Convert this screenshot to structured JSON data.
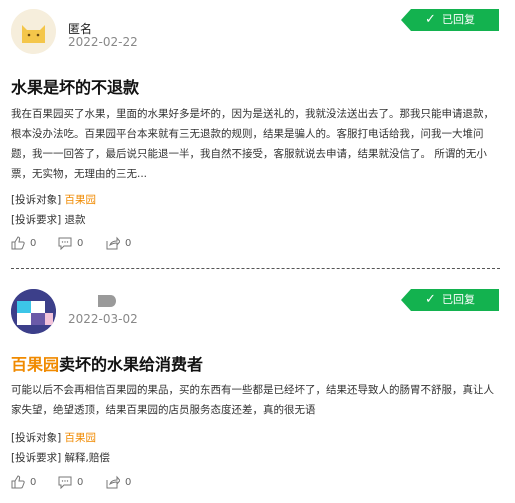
{
  "posts": [
    {
      "user": "匿名",
      "date": "2022-02-22",
      "status": "已回复",
      "title_prefix": "",
      "title": "水果是坏的不退款",
      "content": "我在百果园买了水果，里面的水果好多是坏的，因为是送礼的，我就没法送出去了。那我只能申请退款，根本没办法吃。百果园平台本来就有三无退款的规则，结果是骗人的。客服打电话给我，问我一大堆问题，我一一回答了，最后说只能退一半，我自然不接受，客服就说去申请，结果就没信了。 所谓的无小票，无实物，无理由的三无...",
      "target_label": "[投诉对象]",
      "target_value": "百果园",
      "request_label": "[投诉要求]",
      "request_value": "退款",
      "likes": "0",
      "comments": "0",
      "shares": "0"
    },
    {
      "user": "",
      "date": "2022-03-02",
      "status": "已回复",
      "title_prefix": "百果园",
      "title": "卖坏的水果给消费者",
      "content": "可能以后不会再相信百果园的果品，买的东西有一些都是已经坏了，结果还导致人的肠胃不舒服，真让人家失望，绝望透顶，结果百果园的店员服务态度还差，真的很无语",
      "target_label": "[投诉对象]",
      "target_value": "百果园",
      "request_label": "[投诉要求]",
      "request_value": "解释,赔偿",
      "likes": "0",
      "comments": "0",
      "shares": "0"
    }
  ],
  "colors": {
    "accent": "#f08a00",
    "status_green": "#13b24f"
  },
  "icons": {
    "like": "thumbs-up-icon",
    "comment": "comment-icon",
    "share": "share-icon",
    "check": "checkmark-icon"
  }
}
